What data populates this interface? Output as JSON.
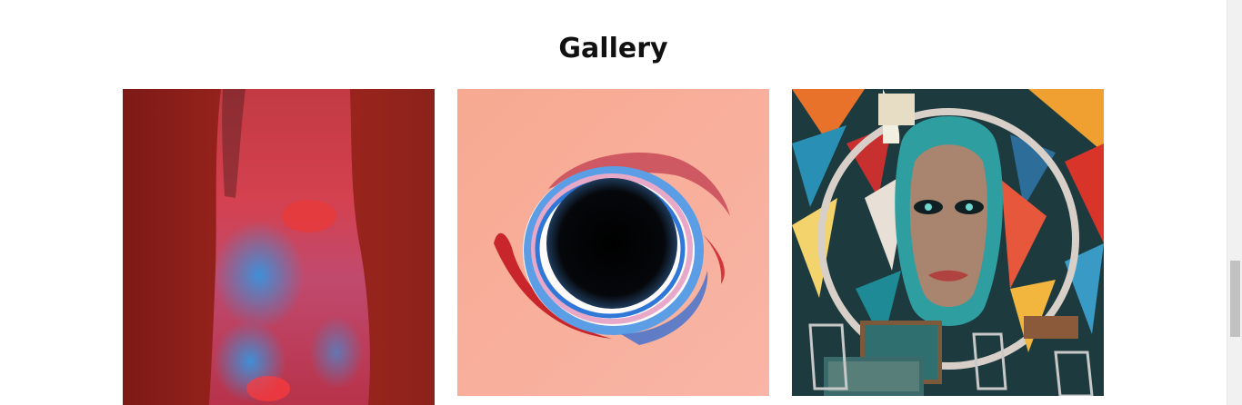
{
  "section": {
    "title": "Gallery"
  },
  "gallery": {
    "items": [
      {
        "icon": "painted-arm-photo"
      },
      {
        "icon": "black-hole-swirl-art"
      },
      {
        "icon": "graffiti-face-mural"
      }
    ]
  },
  "colors": {
    "background": "#ffffff",
    "title_text": "#111111",
    "scrollbar_track": "#f1f1f1",
    "scrollbar_thumb": "#c1c1c1"
  }
}
